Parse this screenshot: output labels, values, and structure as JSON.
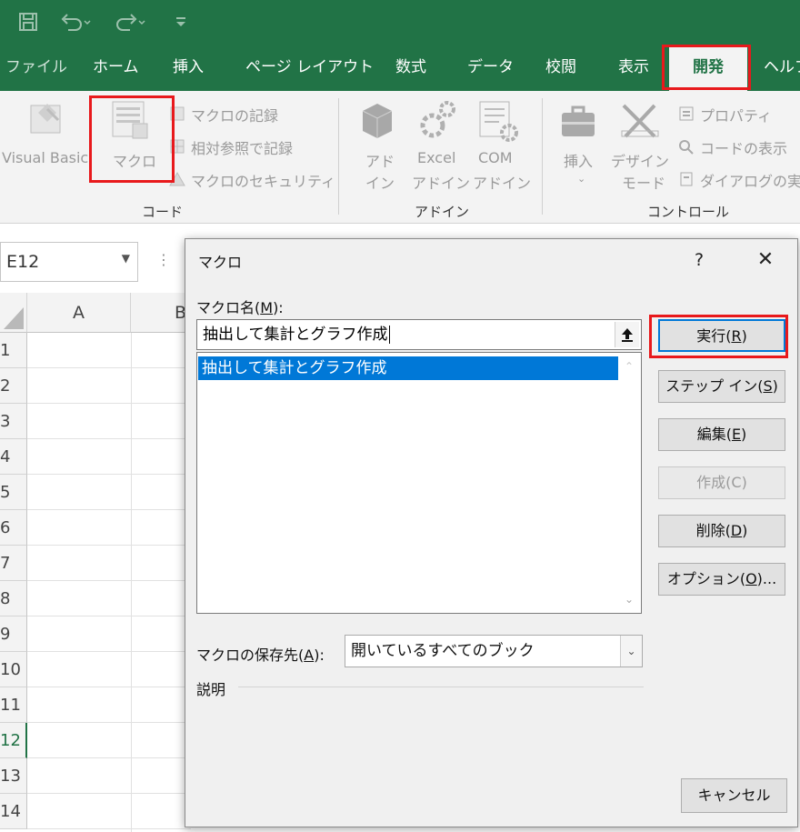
{
  "qat": {
    "save_icon": "save-icon",
    "undo_icon": "undo-icon",
    "redo_icon": "redo-icon",
    "customize_icon": "customize-qat-icon"
  },
  "tabs": {
    "file": "ファイル",
    "home": "ホーム",
    "insert": "挿入",
    "page_layout": "ページ レイアウト",
    "formulas": "数式",
    "data": "データ",
    "review": "校閲",
    "view": "表示",
    "developer": "開発",
    "help": "ヘルプ"
  },
  "ribbon": {
    "code": {
      "group_label": "コード",
      "visual_basic": "Visual Basic",
      "macros": "マクロ",
      "record_macro": "マクロの記録",
      "relative_ref": "相対参照で記録",
      "macro_security": "マクロのセキュリティ"
    },
    "addins": {
      "group_label": "アドイン",
      "addins_line1": "アド",
      "addins_line2": "イン",
      "excel_addins_line1": "Excel",
      "excel_addins_line2": "アドイン",
      "com_addins_line1": "COM",
      "com_addins_line2": "アドイン"
    },
    "controls": {
      "group_label": "コントロール",
      "insert": "挿入",
      "design_mode_line1": "デザイン",
      "design_mode_line2": "モード",
      "properties": "プロパティ",
      "view_code": "コードの表示",
      "run_dialog": "ダイアログの実"
    }
  },
  "namebox": {
    "value": "E12"
  },
  "grid": {
    "col_a": "A",
    "col_b": "B",
    "rows": [
      "1",
      "2",
      "3",
      "4",
      "5",
      "6",
      "7",
      "8",
      "9",
      "10",
      "11",
      "12",
      "13",
      "14"
    ],
    "selected_row": "12"
  },
  "dialog": {
    "title": "マクロ",
    "help": "?",
    "close": "✕",
    "macro_name_label": "マクロ名(",
    "macro_name_mnemonic": "M",
    "macro_name_label_end": "):",
    "macro_name_value": "抽出して集計とグラフ作成",
    "macro_list": [
      "抽出して集計とグラフ作成"
    ],
    "buttons": {
      "run": {
        "label": "実行(",
        "mn": "R",
        "end": ")"
      },
      "step_into": {
        "label": "ステップ イン(",
        "mn": "S",
        "end": ")"
      },
      "edit": {
        "label": "編集(",
        "mn": "E",
        "end": ")"
      },
      "create": "作成(C)",
      "delete": {
        "label": "削除(",
        "mn": "D",
        "end": ")"
      },
      "options": {
        "label": "オプション(",
        "mn": "O",
        "end": ")..."
      }
    },
    "store_label": "マクロの保存先(",
    "store_mn": "A",
    "store_label_end": "):",
    "store_value": "開いているすべてのブック",
    "description_label": "説明",
    "cancel": "キャンセル"
  },
  "colors": {
    "excel_green": "#217346",
    "highlight_red": "#e8191c",
    "selection_blue": "#0078d7"
  }
}
